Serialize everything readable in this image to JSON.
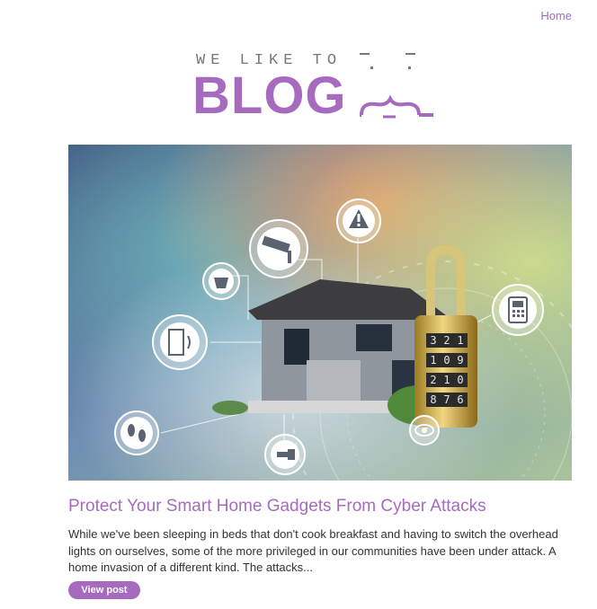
{
  "nav": {
    "home_label": "Home"
  },
  "logo": {
    "tagline": "WE LIKE TO",
    "word": "BLOG"
  },
  "post": {
    "title": "Protect Your Smart Home Gadgets From Cyber Attacks",
    "excerpt": "While we've been sleeping in beds that don't cook breakfast and having to switch the overhead lights on ourselves, some of the more privileged in our communities have been under attack. A home invasion of a different kind. The attacks...",
    "button_label": "View post",
    "padlock_digits": [
      "3",
      "2",
      "1",
      "1",
      "0",
      "9",
      "2",
      "1",
      "0",
      "8",
      "7",
      "6"
    ]
  },
  "colors": {
    "accent": "#a66bbe",
    "text": "#333333"
  },
  "icons": [
    "warning-icon",
    "cctv-camera-icon",
    "smoke-detector-icon",
    "door-icon",
    "footprints-icon",
    "key-icon",
    "eye-icon",
    "intercom-icon",
    "padlock-icon"
  ]
}
